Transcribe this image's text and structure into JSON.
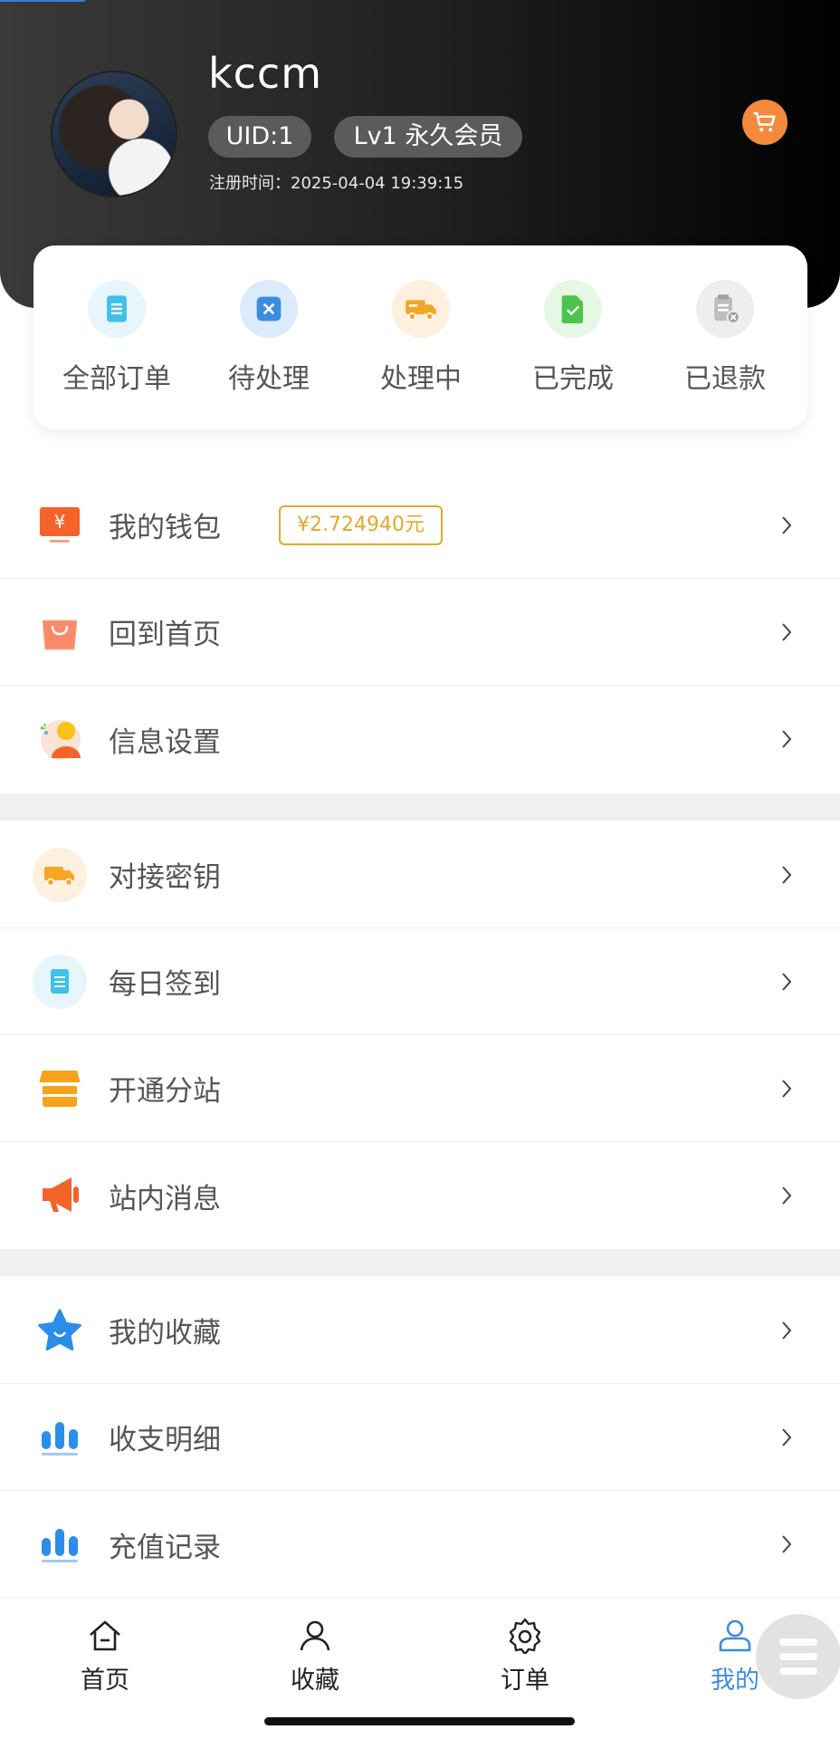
{
  "header": {
    "username": "kccm",
    "uid": "UID:1",
    "level": "Lv1 永久会员",
    "register_time": "注册时间：2025-04-04 19:39:15"
  },
  "orders": [
    {
      "label": "全部订单",
      "icon": "document-icon",
      "color": "#3fc1e9",
      "bg": "#e6f6fc"
    },
    {
      "label": "待处理",
      "icon": "pending-x-icon",
      "color": "#3b8de0",
      "bg": "#dcebfb"
    },
    {
      "label": "处理中",
      "icon": "truck-icon",
      "color": "#f5a623",
      "bg": "#fdf0de"
    },
    {
      "label": "已完成",
      "icon": "check-file-icon",
      "color": "#4cc44c",
      "bg": "#e6f7e6"
    },
    {
      "label": "已退款",
      "icon": "refund-icon",
      "color": "#bdbdbd",
      "bg": "#eeeeee"
    }
  ],
  "menu_group1": [
    {
      "label": "我的钱包",
      "icon": "wallet-icon",
      "badge": "¥2.724940元"
    },
    {
      "label": "回到首页",
      "icon": "shopping-bag-icon"
    },
    {
      "label": "信息设置",
      "icon": "user-settings-icon"
    }
  ],
  "menu_group2": [
    {
      "label": "对接密钥",
      "icon": "truck-icon"
    },
    {
      "label": "每日签到",
      "icon": "document-icon"
    },
    {
      "label": "开通分站",
      "icon": "store-icon"
    },
    {
      "label": "站内消息",
      "icon": "megaphone-icon"
    }
  ],
  "menu_group3": [
    {
      "label": "我的收藏",
      "icon": "star-icon"
    },
    {
      "label": "收支明细",
      "icon": "bar-chart-icon"
    },
    {
      "label": "充值记录",
      "icon": "bar-chart-icon"
    }
  ],
  "bottom_nav": [
    {
      "label": "首页",
      "icon": "home-icon",
      "active": false
    },
    {
      "label": "收藏",
      "icon": "user-icon",
      "active": false
    },
    {
      "label": "订单",
      "icon": "gear-icon",
      "active": false
    },
    {
      "label": "我的",
      "icon": "profile-icon",
      "active": true
    }
  ],
  "colors": {
    "accent": "#3b8de0",
    "badge": "#e3a72e",
    "cart": "#f58a3c"
  }
}
